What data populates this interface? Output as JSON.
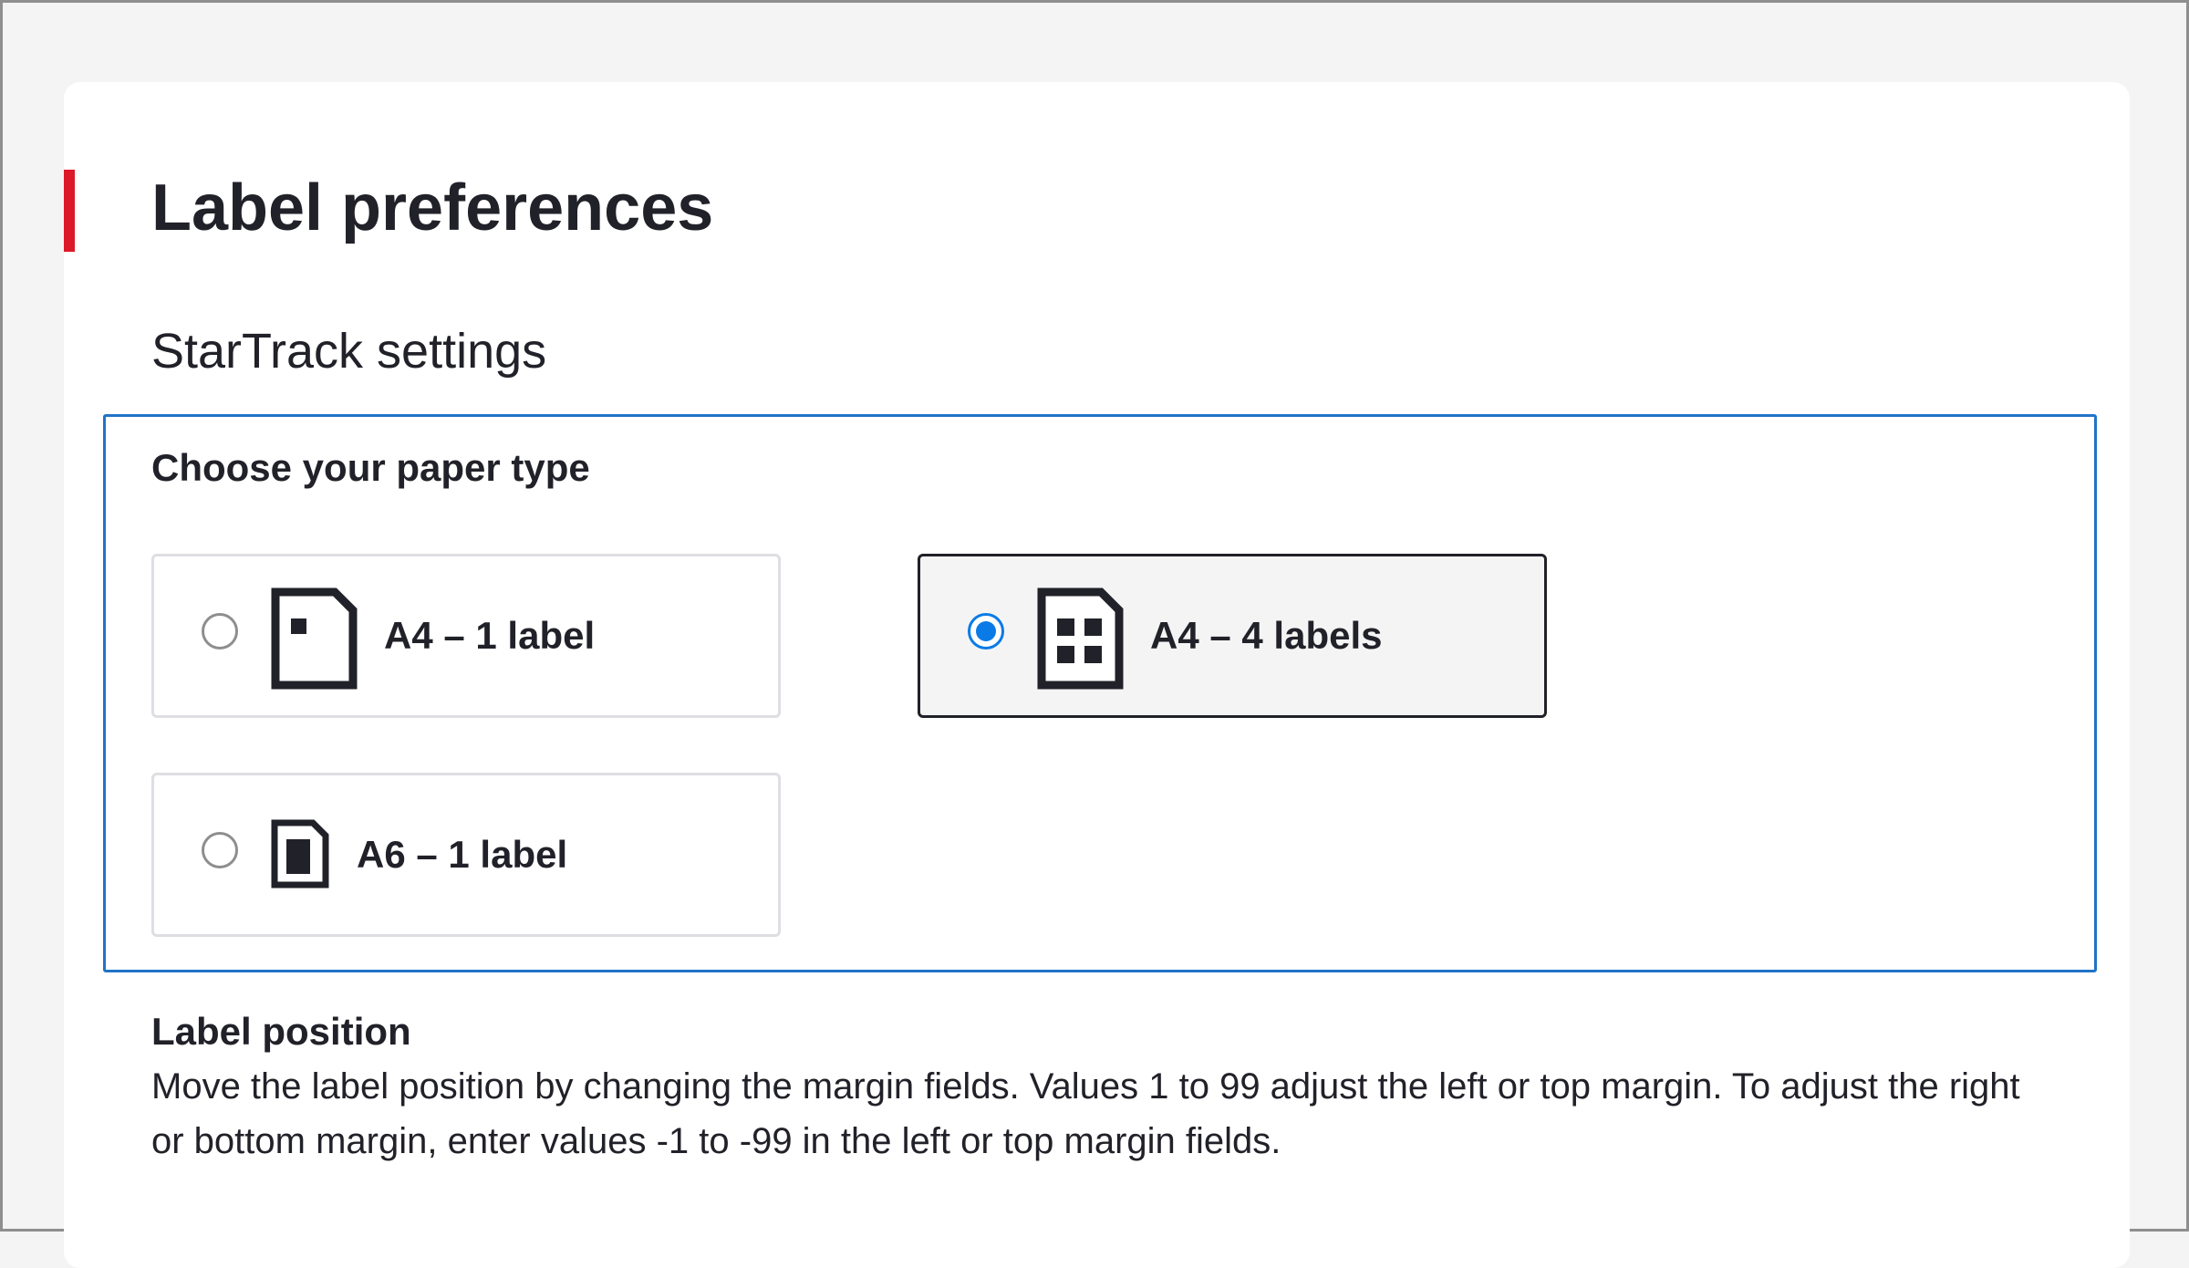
{
  "page": {
    "title": "Label preferences",
    "accent_color": "#dc1928"
  },
  "section": {
    "title": "StarTrack settings"
  },
  "paper_type": {
    "legend": "Choose your paper type",
    "focus_color": "#2173c8",
    "selected_color": "#0a7be6",
    "options": [
      {
        "label": "A4 – 1 label",
        "icon": "a4-single-label-icon",
        "selected": false
      },
      {
        "label": "A4 – 4 labels",
        "icon": "a4-four-labels-icon",
        "selected": true
      },
      {
        "label": "A6 – 1 label",
        "icon": "a6-single-label-icon",
        "selected": false
      }
    ]
  },
  "label_position": {
    "heading": "Label position",
    "description": "Move the label position by changing the margin fields. Values 1 to 99 adjust the left or top margin. To adjust the right or bottom margin, enter values -1 to -99 in the left or top margin fields."
  }
}
